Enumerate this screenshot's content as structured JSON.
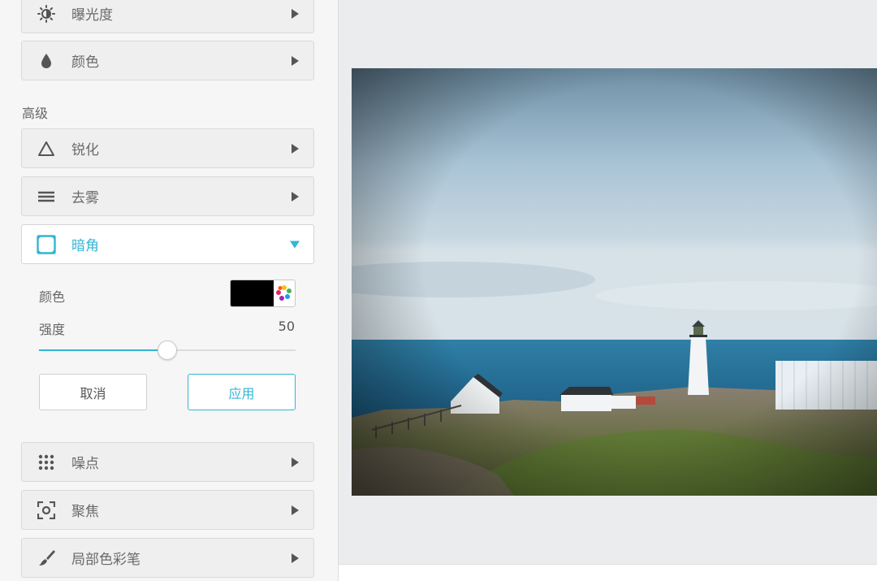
{
  "sidebar": {
    "panels_top": [
      {
        "label": "曝光度",
        "icon": "exposure-icon"
      },
      {
        "label": "颜色",
        "icon": "droplet-icon"
      }
    ],
    "advanced_section_label": "高级",
    "panels_advanced": [
      {
        "label": "锐化",
        "icon": "triangle-icon"
      },
      {
        "label": "去雾",
        "icon": "lines-icon"
      },
      {
        "label": "暗角",
        "icon": "vignette-icon",
        "active": true
      }
    ],
    "vignette": {
      "color_label": "颜色",
      "color_value": "#000000",
      "strength_label": "强度",
      "strength_value": "50",
      "strength_fraction": 0.5,
      "cancel_label": "取消",
      "apply_label": "应用"
    },
    "panels_bottom": [
      {
        "label": "噪点",
        "icon": "grid-dots-icon"
      },
      {
        "label": "聚焦",
        "icon": "focus-icon"
      },
      {
        "label": "局部色彩笔",
        "icon": "brush-icon"
      }
    ]
  },
  "colors": {
    "accent": "#33b5d6",
    "panel_bg": "#efefef",
    "sidebar_bg": "#f6f6f6",
    "canvas_bg": "#ebecee"
  }
}
